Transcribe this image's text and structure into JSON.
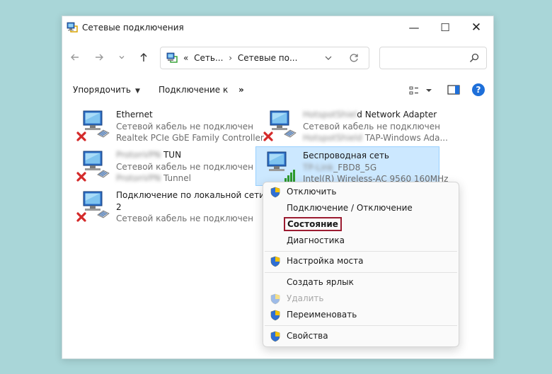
{
  "window": {
    "title": "Сетевые подключения",
    "controls": {
      "minimize": "—",
      "maximize": "☐",
      "close": "✕"
    }
  },
  "nav": {
    "back_icon": "arrow-left-icon",
    "forward_icon": "arrow-right-icon",
    "recent_icon": "chevron-down-icon",
    "up_icon": "arrow-up-icon",
    "address": {
      "prefix": "«",
      "crumbs": [
        "Сеть...",
        "Сетевые по..."
      ],
      "separator": "›"
    },
    "search": {
      "placeholder": ""
    }
  },
  "toolbar": {
    "organize": "Упорядочить",
    "connect": "Подключение к",
    "more": "»",
    "help": "?"
  },
  "connections": [
    {
      "name": "Ethernet",
      "status": "Сетевой кабель не подключен",
      "device": "Realtek PCIe GbE Family Controller",
      "state": "disconnected"
    },
    {
      "name": "HotspotShield Network Adapter",
      "name_visible": "d Network Adapter",
      "name_blur": "HotspotShiel",
      "status": "Сетевой кабель не подключен",
      "device_blur": "HotspotShield",
      "device": "TAP-Windows Ada...",
      "state": "disconnected"
    },
    {
      "name_blur": "ProtonVPN",
      "name": "TUN",
      "status": "Сетевой кабель не подключен",
      "device_blur": "ProtonVPN",
      "device": "Tunnel",
      "state": "disconnected"
    },
    {
      "name": "Беспроводная сеть",
      "status_blur": "TP-Link",
      "status": "_FBD8_5G",
      "device": "Intel(R) Wireless-AC 9560 160MHz",
      "state": "wireless",
      "selected": true
    },
    {
      "name_line1": "Подключение по локальной сети",
      "name_line2": "2",
      "status": "Сетевой кабель не подключен",
      "state": "disconnected"
    }
  ],
  "context_menu": [
    {
      "label": "Отключить",
      "shield": true,
      "bold": true
    },
    {
      "label": "Подключение / Отключение"
    },
    {
      "label": "Состояние",
      "bold": true,
      "highlighted": true
    },
    {
      "label": "Диагностика"
    },
    {
      "separator": true
    },
    {
      "label": "Настройка моста",
      "shield": true
    },
    {
      "separator": true
    },
    {
      "label": "Создать ярлык"
    },
    {
      "label": "Удалить",
      "shield": true,
      "disabled": true
    },
    {
      "label": "Переименовать",
      "shield": true
    },
    {
      "separator": true
    },
    {
      "label": "Свойства",
      "shield": true
    }
  ],
  "colors": {
    "background": "#a9d6d8",
    "selection": "#cce8ff",
    "highlight_box": "#9b1b30",
    "help_blue": "#1e6fd9",
    "error_red": "#d42a2a",
    "signal_green": "#2e9a2e"
  }
}
